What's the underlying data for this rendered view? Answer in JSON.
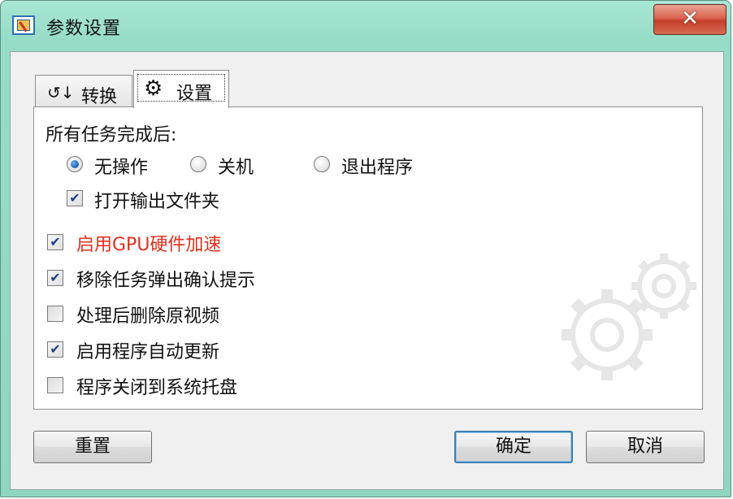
{
  "window": {
    "title": "参数设置",
    "close_label": "✕"
  },
  "tabs": [
    {
      "icon": "↺↓",
      "label": "转换"
    },
    {
      "icon": "⚙",
      "label": "设置"
    }
  ],
  "settings": {
    "after_complete_label": "所有任务完成后:",
    "radios": [
      {
        "label": "无操作",
        "selected": true
      },
      {
        "label": "关机",
        "selected": false
      },
      {
        "label": "退出程序",
        "selected": false
      }
    ],
    "open_output_folder": {
      "label": "打开输出文件夹",
      "checked": true
    },
    "options": [
      {
        "label": "启用GPU硬件加速",
        "checked": true,
        "highlight_color": "#e0301e"
      },
      {
        "label": "移除任务弹出确认提示",
        "checked": true
      },
      {
        "label": "处理后删除原视频",
        "checked": false
      },
      {
        "label": "启用程序自动更新",
        "checked": true
      },
      {
        "label": "程序关闭到系统托盘",
        "checked": false
      }
    ]
  },
  "buttons": {
    "reset": "重置",
    "ok": "确定",
    "cancel": "取消"
  },
  "check_mark": "✔"
}
